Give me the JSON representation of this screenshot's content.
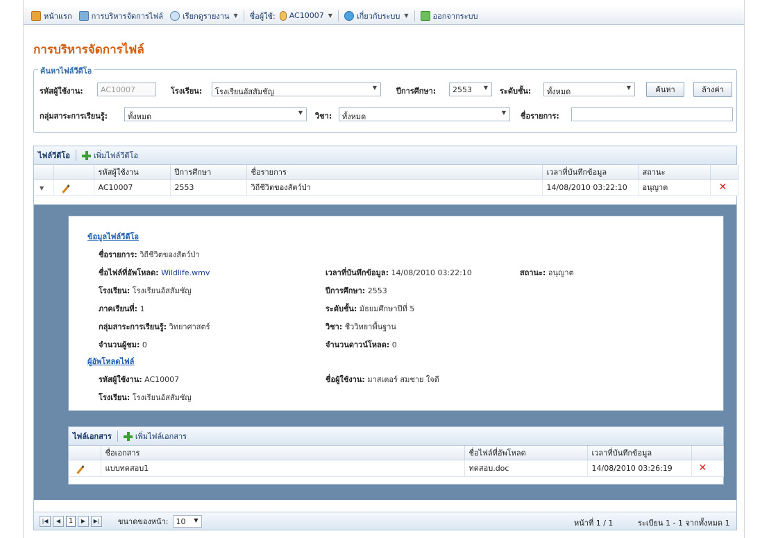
{
  "menu": {
    "home": "หน้าแรก",
    "file_mgmt": "การบริหารจัดการไฟล์",
    "report": "เรียกดูรายงาน",
    "user_label": "ชื่อผู้ใช้:",
    "user_id": "AC10007",
    "about": "เกี่ยวกับระบบ",
    "logout": "ออกจากระบบ"
  },
  "page_title": "การบริหารจัดการไฟล์",
  "search": {
    "legend": "ค้นหาไฟล์วีดีโอ",
    "user_id_label": "รหัสผู้ใช้งาน:",
    "user_id_value": "AC10007",
    "school_label": "โรงเรียน:",
    "school_value": "โรงเรียนอัสสัมชัญ",
    "year_label": "ปีการศึกษา:",
    "year_value": "2553",
    "level_label": "ระดับชั้น:",
    "level_value": "ทั้งหมด",
    "search_button": "ค้นหา",
    "reset_button": "ล้างค่า",
    "group_label": "กลุ่มสาระการเรียนรู้:",
    "group_value": "ทั้งหมด",
    "subject_label": "วิชา:",
    "subject_value": "ทั้งหมด",
    "title_label": "ชื่อรายการ:",
    "title_value": ""
  },
  "grid": {
    "title": "ไฟล์วีดีโอ",
    "add_label": "เพิ่มไฟล์วีดีโอ",
    "columns": [
      "รหัสผู้ใช้งาน",
      "ปีการศึกษา",
      "ชื่อรายการ",
      "เวลาที่บันทึกข้อมูล",
      "สถานะ"
    ],
    "rows": [
      {
        "user_id": "AC10007",
        "year": "2553",
        "title": "วิถีชีวิตของสัตว์ป่า",
        "timestamp": "14/08/2010 03:22:10",
        "status": "อนุญาต"
      }
    ]
  },
  "detail": {
    "file_info_heading": "ข้อมูลไฟล์วีดีโอ",
    "title_label": "ชื่อรายการ:",
    "title_value": "วิถีชีวิตของสัตว์ป่า",
    "upload_file_label": "ชื่อไฟล์ที่อัพโหลด:",
    "upload_file_value": "Wildlife.wmv",
    "saved_time_label": "เวลาที่บันทึกข้อมูล:",
    "saved_time_value": "14/08/2010 03:22:10",
    "status_label": "สถานะ:",
    "status_value": "อนุญาต",
    "school_label": "โรงเรียน:",
    "school_value": "โรงเรียนอัสสัมชัญ",
    "year_label": "ปีการศึกษา:",
    "year_value": "2553",
    "semester_label": "ภาคเรียนที่:",
    "semester_value": "1",
    "level_label": "ระดับชั้น:",
    "level_value": "มัธยมศึกษาปีที่ 5",
    "group_label": "กลุ่มสาระการเรียนรู้:",
    "group_value": "วิทยาศาสตร์",
    "subject_label": "วิชา:",
    "subject_value": "ชีววิทยาพื้นฐาน",
    "views_label": "จำนวนผู้ชม:",
    "views_value": "0",
    "downloads_label": "จำนวนดาวน์โหลด:",
    "downloads_value": "0",
    "uploader_heading": "ผู้อัพโหลดไฟล์",
    "uploader_id_label": "รหัสผู้ใช้งาน:",
    "uploader_id_value": "AC10007",
    "uploader_name_label": "ชื่อผู้ใช้งาน:",
    "uploader_name_value": "มาสเตอร์ สมชาย ใจดี",
    "uploader_school_label": "โรงเรียน:",
    "uploader_school_value": "โรงเรียนอัสสัมชัญ"
  },
  "docs": {
    "title": "ไฟล์เอกสาร",
    "add_label": "เพิ่มไฟล์เอกสาร",
    "columns": [
      "ชื่อเอกสาร",
      "ชื่อไฟล์ที่อัพโหลด",
      "เวลาที่บันทึกข้อมูล"
    ],
    "rows": [
      {
        "name": "แบบทดสอบ1",
        "file": "ทดสอบ.doc",
        "timestamp": "14/08/2010 03:26:19"
      }
    ]
  },
  "pager": {
    "current_page": "1",
    "page_size_label": "ขนาดของหน้า:",
    "page_size_value": "10",
    "page_info": "หน้าที่ 1 / 1",
    "record_info": "ระเบียน 1 - 1 จากทั้งหมด 1"
  },
  "colors": {
    "title_orange": "#d25f10",
    "link_blue": "#1f5fb3",
    "detail_bg": "#6b8aaa",
    "delete_red": "#d32222"
  }
}
